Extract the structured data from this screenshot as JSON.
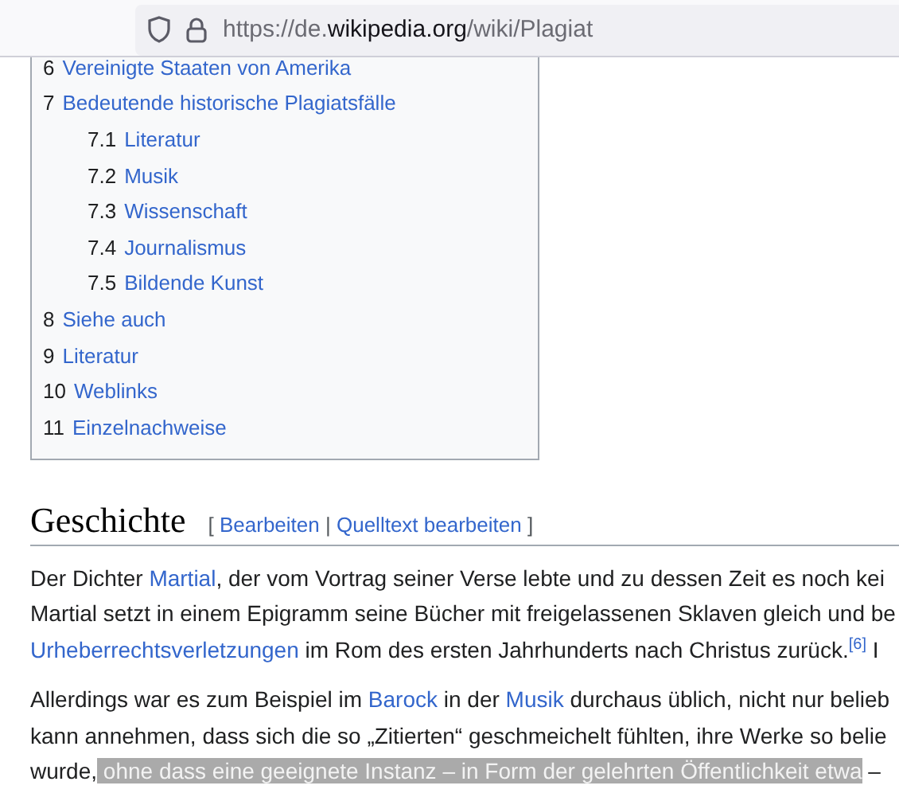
{
  "address_bar": {
    "url_prefix": "https://de.",
    "url_domain": "wikipedia.org",
    "url_path": "/wiki/Plagiat"
  },
  "toc": {
    "items": [
      {
        "number": "6",
        "label": "Vereinigte Staaten von Amerika"
      },
      {
        "number": "7",
        "label": "Bedeutende historische Plagiatsfälle",
        "children": [
          {
            "number": "7.1",
            "label": "Literatur"
          },
          {
            "number": "7.2",
            "label": "Musik"
          },
          {
            "number": "7.3",
            "label": "Wissenschaft"
          },
          {
            "number": "7.4",
            "label": "Journalismus"
          },
          {
            "number": "7.5",
            "label": "Bildende Kunst"
          }
        ]
      },
      {
        "number": "8",
        "label": "Siehe auch"
      },
      {
        "number": "9",
        "label": "Literatur"
      },
      {
        "number": "10",
        "label": "Weblinks"
      },
      {
        "number": "11",
        "label": "Einzelnachweise"
      }
    ]
  },
  "section": {
    "heading": "Geschichte",
    "edit_open": "[",
    "edit_links": [
      "Bearbeiten",
      "Quelltext bearbeiten"
    ],
    "edit_separator": "|",
    "edit_close": "]",
    "paragraphs": [
      [
        [
          {
            "kind": "text",
            "text": "Der Dichter "
          },
          {
            "kind": "link",
            "text": "Martial"
          },
          {
            "kind": "text",
            "text": ", der vom Vortrag seiner Verse lebte und zu dessen Zeit es noch kei"
          }
        ],
        [
          {
            "kind": "text",
            "text": "Martial setzt in einem Epigramm seine Bücher mit freigelassenen Sklaven gleich und be"
          }
        ],
        [
          {
            "kind": "link",
            "text": "Urheberrechtsverletzungen"
          },
          {
            "kind": "text",
            "text": " im Rom des ersten Jahrhunderts nach Christus zurück."
          },
          {
            "kind": "ref",
            "text": "[6]"
          },
          {
            "kind": "text",
            "text": " I"
          }
        ]
      ],
      [
        [
          {
            "kind": "text",
            "text": "Allerdings war es zum Beispiel im "
          },
          {
            "kind": "link",
            "text": "Barock"
          },
          {
            "kind": "text",
            "text": " in der "
          },
          {
            "kind": "link",
            "text": "Musik"
          },
          {
            "kind": "text",
            "text": " durchaus üblich, nicht nur belieb"
          }
        ],
        [
          {
            "kind": "text",
            "text": "kann annehmen, dass sich die so „Zitierten“ geschmeichelt fühlten, ihre Werke so belie"
          }
        ],
        [
          {
            "kind": "text",
            "text": "wurde,"
          },
          {
            "kind": "highlight",
            "text": " ohne dass eine geeignete Instanz – in Form der gelehrten Öffentlichkeit etwa"
          },
          {
            "kind": "text",
            "text": " –"
          }
        ]
      ]
    ]
  }
}
